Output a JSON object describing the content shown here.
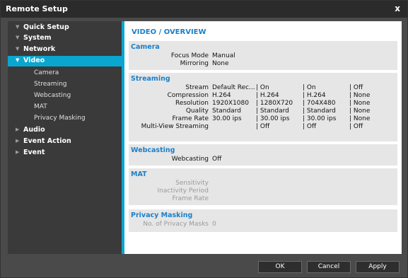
{
  "window": {
    "title": "Remote Setup",
    "close_glyph": "x"
  },
  "sidebar": {
    "items": [
      {
        "label": "Quick Setup",
        "arrow": "▼"
      },
      {
        "label": "System",
        "arrow": "▼"
      },
      {
        "label": "Network",
        "arrow": "▼"
      },
      {
        "label": "Video",
        "arrow": "▼",
        "selected": true
      },
      {
        "label": "Audio",
        "arrow": "▶"
      },
      {
        "label": "Event Action",
        "arrow": "▶"
      },
      {
        "label": "Event",
        "arrow": "▶"
      }
    ],
    "video_sub": [
      "Camera",
      "Streaming",
      "Webcasting",
      "MAT",
      "Privacy Masking"
    ]
  },
  "content": {
    "title": "VIDEO / OVERVIEW",
    "camera": {
      "title": "Camera",
      "rows": [
        {
          "label": "Focus Mode",
          "value": "Manual"
        },
        {
          "label": "Mirroring",
          "value": "None"
        }
      ]
    },
    "streaming": {
      "title": "Streaming",
      "rows": [
        {
          "label": "Stream",
          "cols": [
            "Default Rec...",
            "| On",
            "| On",
            "| Off"
          ]
        },
        {
          "label": "Compression",
          "cols": [
            "H.264",
            "| H.264",
            "| H.264",
            "| None"
          ]
        },
        {
          "label": "Resolution",
          "cols": [
            "1920X1080",
            "| 1280X720",
            "| 704X480",
            "| None"
          ]
        },
        {
          "label": "Quality",
          "cols": [
            "Standard",
            "| Standard",
            "| Standard",
            "| None"
          ]
        },
        {
          "label": "Frame Rate",
          "cols": [
            "30.00 ips",
            "| 30.00 ips",
            "| 30.00 ips",
            "| None"
          ]
        },
        {
          "label": "Multi-View Streaming",
          "cols": [
            "",
            "| Off",
            "| Off",
            "| Off"
          ]
        }
      ]
    },
    "webcasting": {
      "title": "Webcasting",
      "rows": [
        {
          "label": "Webcasting",
          "value": "Off"
        }
      ]
    },
    "mat": {
      "title": "MAT",
      "rows": [
        {
          "label": "Sensitivity",
          "value": ""
        },
        {
          "label": "Inactivity Period",
          "value": ""
        },
        {
          "label": "Frame Rate",
          "value": ""
        }
      ]
    },
    "privacy": {
      "title": "Privacy Masking",
      "rows": [
        {
          "label": "No. of Privacy Masks",
          "value": "0"
        }
      ]
    }
  },
  "buttons": {
    "ok": "OK",
    "cancel": "Cancel",
    "apply": "Apply"
  },
  "colors": {
    "accent": "#0aa6cf",
    "section_title": "#1a7fc8",
    "sidebar_bg": "#3a3a3a",
    "frame_bg": "#4a4a4a"
  }
}
